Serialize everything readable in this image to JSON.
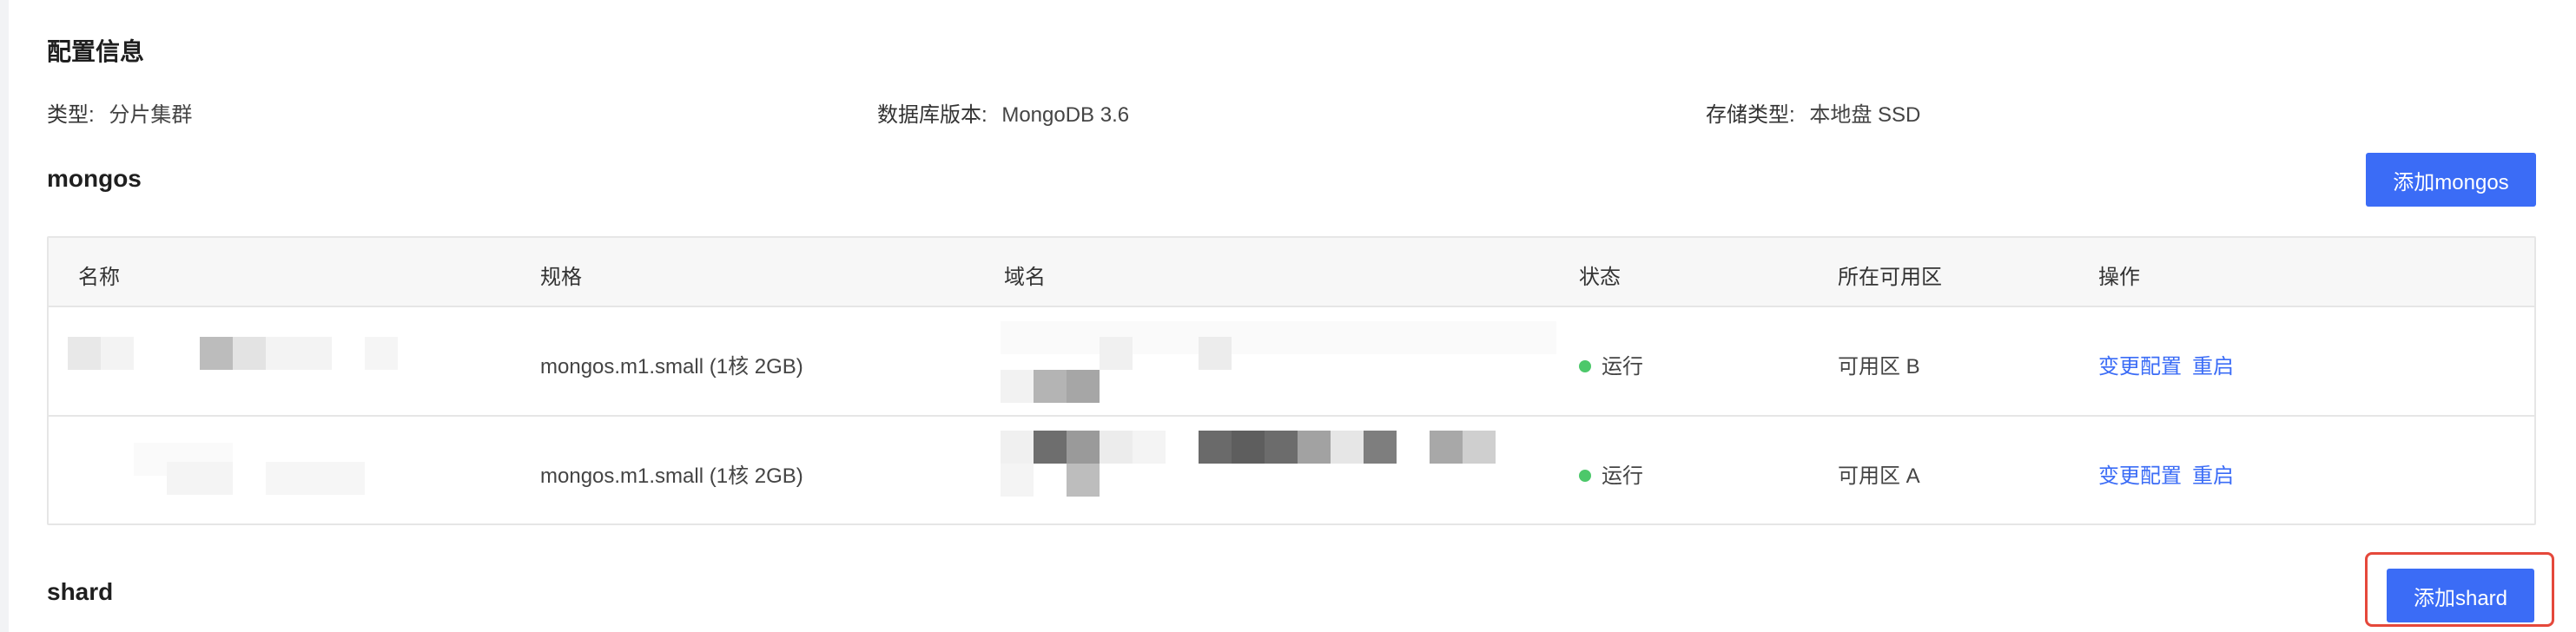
{
  "config": {
    "title": "配置信息",
    "type_label": "类型:",
    "type_value": "分片集群",
    "db_version_label": "数据库版本:",
    "db_version_value": "MongoDB 3.6",
    "storage_label": "存储类型:",
    "storage_value": "本地盘 SSD"
  },
  "mongos": {
    "title": "mongos",
    "add_button": "添加mongos",
    "columns": [
      "名称",
      "规格",
      "域名",
      "状态",
      "所在可用区",
      "操作"
    ],
    "rows": [
      {
        "spec": "mongos.m1.small (1核 2GB)",
        "status": "运行",
        "zone": "可用区 B",
        "action_change": "变更配置",
        "action_restart": "重启"
      },
      {
        "spec": "mongos.m1.small (1核 2GB)",
        "status": "运行",
        "zone": "可用区 A",
        "action_change": "变更配置",
        "action_restart": "重启"
      }
    ]
  },
  "shard": {
    "title": "shard",
    "add_button": "添加shard"
  },
  "colors": {
    "primary": "#3b6cf6",
    "status_running": "#4cc86a",
    "highlight": "#e5483b"
  }
}
